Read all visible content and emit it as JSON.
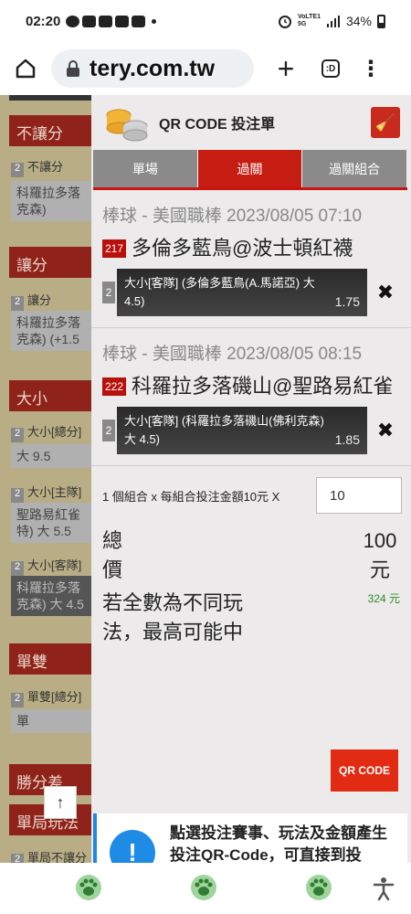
{
  "status_bar": {
    "time": "02:20",
    "net_top": "VoLTE1",
    "net_bottom": "5G",
    "battery": "34%"
  },
  "browser": {
    "url": "tery.com.tw"
  },
  "background_page": {
    "sections": [
      {
        "title": "不讓分",
        "num": "2",
        "label": "不讓分",
        "box": "科羅拉多落 克森)"
      },
      {
        "title": "讓分",
        "num": "2",
        "label": "讓分",
        "box": "科羅拉多落 克森) (+1.5"
      },
      {
        "title": "大小",
        "num": "2",
        "label": "大小[總分]",
        "box": "大 9.5",
        "num2": "2",
        "label2": "大小[主隊]",
        "box2": "聖路易紅雀 特) 大 5.5",
        "num3": "2",
        "label3": "大小[客隊]",
        "box3": "科羅拉多落 克森) 大 4.5"
      },
      {
        "title": "單雙",
        "num": "2",
        "label": "單雙[總分]",
        "box": "單"
      },
      {
        "title": "勝分差"
      },
      {
        "title": "單局玩法",
        "num": "2",
        "label": "單局不讓分"
      }
    ]
  },
  "panel": {
    "title": "QR CODE 投注單",
    "tabs": [
      "單場",
      "過關",
      "過關組合"
    ],
    "active_tab": "過關",
    "matches": [
      {
        "league": "棒球 - 美國職棒 2023/08/05 07:10",
        "code": "217",
        "teams": "多倫多藍鳥@波士頓紅襪",
        "bet_num": "2",
        "bet_desc": "大小[客隊] (多倫多藍鳥(A.馬諾亞) 大 4.5)",
        "odds": "1.75"
      },
      {
        "league": "棒球 - 美國職棒 2023/08/05 08:15",
        "code": "222",
        "teams": "科羅拉多落磯山@聖路易紅雀",
        "bet_num": "2",
        "bet_desc": "大小[客隊] (科羅拉多落磯山(佛利克森) 大 4.5)",
        "odds": "1.85"
      }
    ],
    "combo_text": "1 個組合 x 每組合投注金額10元 X",
    "amount_value": "10",
    "total_label": "總價",
    "total_value": "100元",
    "max_label": "若全數為不同玩法，最高可能中",
    "max_value": "324 元",
    "qr_button": "QR CODE",
    "info_text": "點選投注賽事、玩法及金額產生投注QR-Code，可直接到投"
  },
  "colors": {
    "accent_red": "#c61d13",
    "tab_grey": "#8a8a8a",
    "info_blue": "#1e88e5",
    "win_green": "#2e8b2e"
  }
}
